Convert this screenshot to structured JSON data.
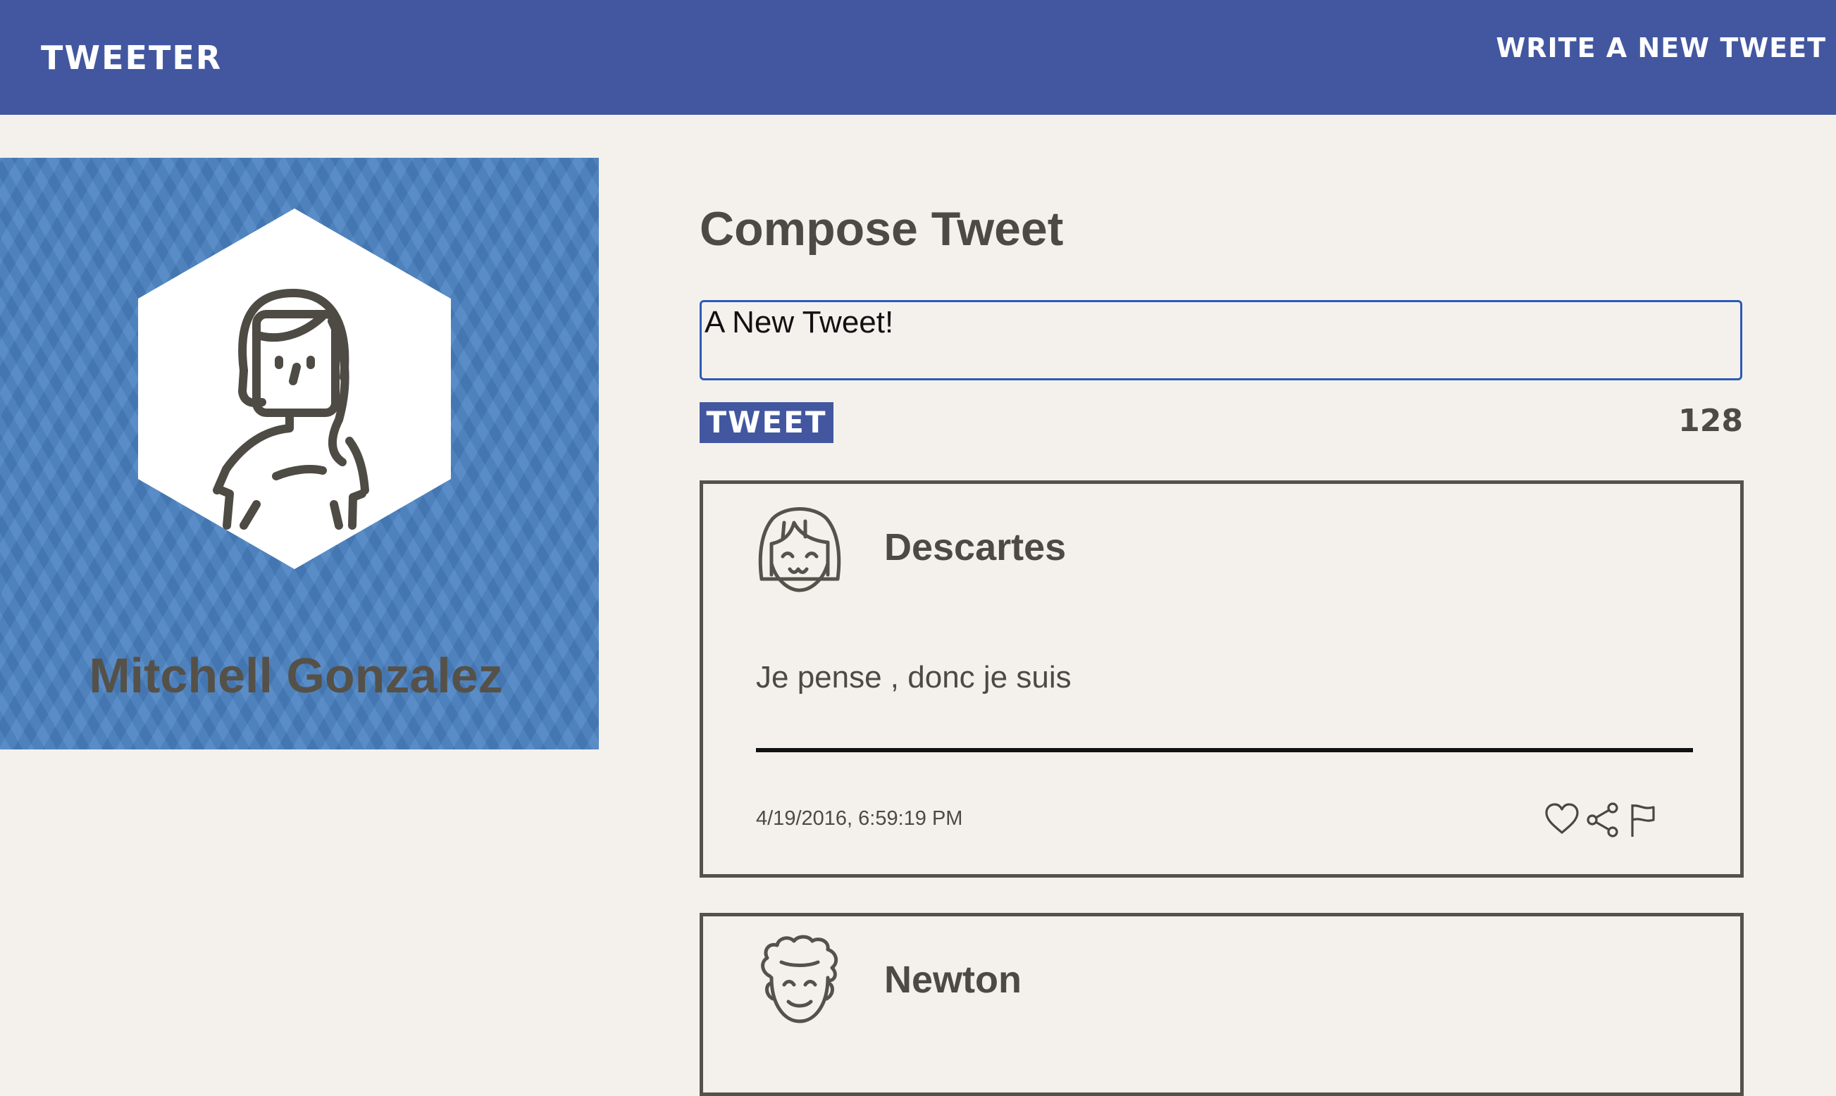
{
  "header": {
    "brand": "TWEETER",
    "write_link": "WRITE A NEW TWEET"
  },
  "profile": {
    "name": "Mitchell Gonzalez",
    "avatar_icon": "female-user-avatar-icon",
    "background_color": "#4a82c2"
  },
  "compose": {
    "title": "Compose Tweet",
    "input_value": "A New Tweet!",
    "button_label": "TWEET",
    "char_counter": "128"
  },
  "tweets": [
    {
      "author": "Descartes",
      "text": "Je pense , donc je suis",
      "timestamp": "4/19/2016, 6:59:19 PM",
      "avatar_icon": "descartes-avatar-icon",
      "actions": [
        "heart-icon",
        "share-icon",
        "flag-icon"
      ]
    },
    {
      "author": "Newton",
      "avatar_icon": "newton-avatar-icon"
    }
  ],
  "colors": {
    "navbar": "#4257a0",
    "page_background": "#f4f1ed",
    "text": "#4c4a45",
    "input_border": "#2c5bb5"
  }
}
